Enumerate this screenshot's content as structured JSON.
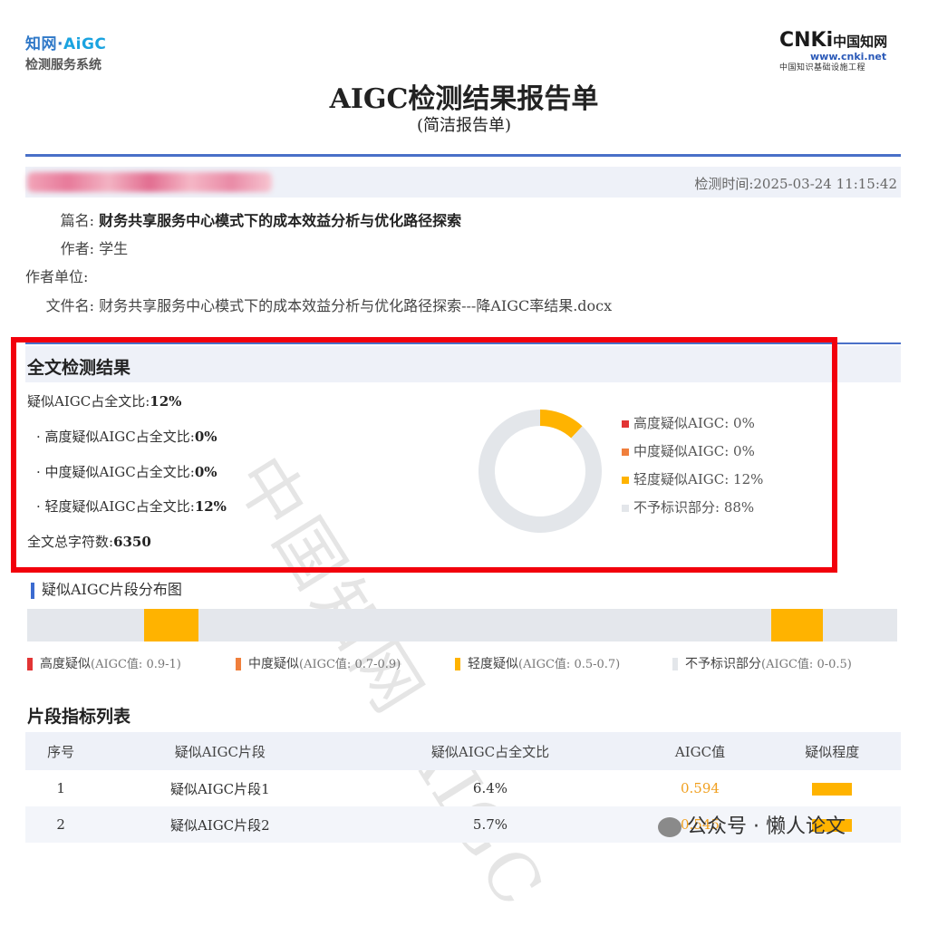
{
  "header": {
    "logo_left_line1_a": "知网·",
    "logo_left_line1_b": "AiGC",
    "logo_left_line2": "检测服务系统",
    "logo_right_brand": "CNKi",
    "logo_right_cn": "中国知网",
    "logo_right_url": "www.cnki.net",
    "logo_right_slogan": "中国知识基础设施工程",
    "title": "AIGC检测结果报告单",
    "subtitle": "(简洁报告单)"
  },
  "meta": {
    "time": "检测时间:2025-03-24 11:15:42",
    "title_label": "篇名:",
    "title_value": "财务共享服务中心模式下的成本效益分析与优化路径探索",
    "author_label": "作者:",
    "author_value": "学生",
    "org_label": "作者单位:",
    "org_value": "",
    "file_label": "文件名:",
    "file_value": "财务共享服务中心模式下的成本效益分析与优化路径探索---降AIGC率结果.docx"
  },
  "summary": {
    "heading": "全文检测结果",
    "total_label": "疑似AIGC占全文比:",
    "total_value": "12%",
    "high_label": "· 高度疑似AIGC占全文比:",
    "high_value": "0%",
    "mid_label": "· 中度疑似AIGC占全文比:",
    "mid_value": "0%",
    "low_label": "· 轻度疑似AIGC占全文比:",
    "low_value": "12%",
    "chars_label": "全文总字符数:",
    "chars_value": "6350",
    "legend": [
      {
        "label": "高度疑似AIGC: 0%",
        "color": "#e23434"
      },
      {
        "label": "中度疑似AIGC: 0%",
        "color": "#f07f3c"
      },
      {
        "label": "轻度疑似AIGC: 12%",
        "color": "#ffb300"
      },
      {
        "label": "不予标识部分: 88%",
        "color": "#e3e6ea"
      }
    ],
    "watermark": "中国知网 AIGC"
  },
  "chart_data": {
    "type": "pie",
    "categories": [
      "高度疑似AIGC",
      "中度疑似AIGC",
      "轻度疑似AIGC",
      "不予标识部分"
    ],
    "values": [
      0,
      0,
      12,
      88
    ],
    "colors": [
      "#e23434",
      "#f07f3c",
      "#ffb300",
      "#e3e6ea"
    ]
  },
  "distribution": {
    "title": "疑似AIGC片段分布图",
    "segments": [
      {
        "start_fraction": 0.134,
        "end_fraction": 0.197,
        "level": "轻度疑似"
      },
      {
        "start_fraction": 0.855,
        "end_fraction": 0.915,
        "level": "轻度疑似"
      }
    ],
    "legend": [
      {
        "label": "高度疑似",
        "range": "(AIGC值: 0.9-1)",
        "color": "#e23434"
      },
      {
        "label": "中度疑似",
        "range": "(AIGC值: 0.7-0.9)",
        "color": "#f07f3c"
      },
      {
        "label": "轻度疑似",
        "range": "(AIGC值: 0.5-0.7)",
        "color": "#ffb300"
      },
      {
        "label": "不予标识部分",
        "range": "(AIGC值: 0-0.5)",
        "color": "#e3e6ea"
      }
    ]
  },
  "fragments": {
    "title": "片段指标列表",
    "headers": [
      "序号",
      "疑似AIGC片段",
      "疑似AIGC占全文比",
      "AIGC值",
      "疑似程度"
    ],
    "rows": [
      {
        "index": "1",
        "name": "疑似AIGC片段1",
        "ratio": "6.4%",
        "aigc": "0.594"
      },
      {
        "index": "2",
        "name": "疑似AIGC片段2",
        "ratio": "5.7%",
        "aigc": "0.545"
      }
    ]
  },
  "footer": {
    "watermark": "公众号 · 懒人论文"
  }
}
